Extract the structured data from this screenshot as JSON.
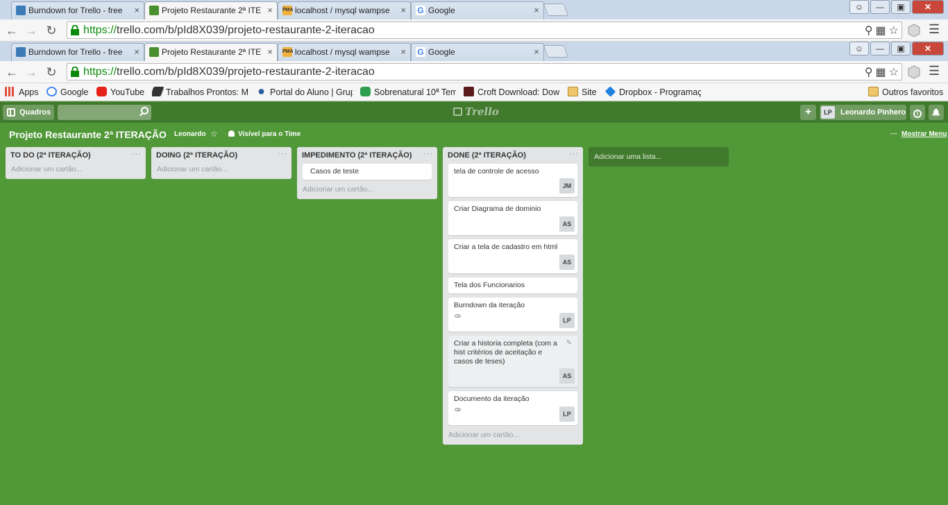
{
  "browser": {
    "tabs": [
      {
        "title": "Burndown for Trello - free",
        "icon": "trello-icon",
        "active": false
      },
      {
        "title": "Projeto Restaurante 2ª ITE",
        "icon": "trello-icon",
        "active": true
      },
      {
        "title": "localhost / mysql wampse",
        "icon": "phpmyadmin-icon",
        "active": false
      },
      {
        "title": "Google",
        "icon": "google-icon",
        "active": false
      }
    ],
    "tab_close": "×",
    "url_scheme": "https://",
    "url_rest": "trello.com/b/pId8X039/projeto-restaurante-2-iteracao",
    "pma_label": "PMA",
    "google_glyph": "G"
  },
  "bookmarks": [
    {
      "label": "Apps",
      "icon": "apps-icon"
    },
    {
      "label": "Google",
      "icon": "google-icon"
    },
    {
      "label": "YouTube",
      "icon": "youtube-icon"
    },
    {
      "label": "Trabalhos Prontos: Mo",
      "icon": "bookmark-icon"
    },
    {
      "label": "Portal do Aluno | Grup",
      "icon": "portal-icon"
    },
    {
      "label": "Sobrenatural 10ª Tem",
      "icon": "tv-icon"
    },
    {
      "label": "Croft Download: Dow",
      "icon": "croft-icon"
    },
    {
      "label": "Site",
      "icon": "folder-icon"
    },
    {
      "label": "Dropbox - Programaç",
      "icon": "dropbox-icon"
    },
    {
      "label": "Outros favoritos",
      "icon": "folder-icon"
    }
  ],
  "trello_header": {
    "boards_button": "Quadros",
    "logo": "Trello",
    "add_symbol": "+",
    "member_initials": "LP",
    "member_name": "Leonardo Pinhero",
    "info_symbol": "i",
    "notif_symbol": "🔔"
  },
  "board": {
    "title": "Projeto Restaurante 2ª ITERAÇÃO",
    "org": "Leonardo",
    "star": "☆",
    "visibility": "Visível para o Time",
    "menu_dots": "···",
    "show_menu": "Mostrar Menu"
  },
  "lists": [
    {
      "title": "TO DO (2ª ITERAÇÃO)",
      "menu": "···",
      "cards": [],
      "add_card": "Adicionar um cartão..."
    },
    {
      "title": "DOING (2ª ITERAÇÃO)",
      "menu": "···",
      "cards": [],
      "add_card": "Adicionar um cartão..."
    },
    {
      "title": "IMPEDIMENTO (2ª ITERAÇÃO)",
      "menu": "···",
      "cards": [
        {
          "title": "Casos de teste",
          "member": "",
          "watched": false
        }
      ],
      "add_card": "Adicionar um cartão..."
    },
    {
      "title": "DONE (2ª ITERAÇÃO)",
      "menu": "···",
      "cards": [
        {
          "title": "tela de controle de acesso",
          "member": "JM",
          "watched": false
        },
        {
          "title": "Criar Diagrama de dominio",
          "member": "AS",
          "watched": false
        },
        {
          "title": "Criar a tela de cadastro em html",
          "member": "AS",
          "watched": false
        },
        {
          "title": "Tela dos Funcionarios",
          "member": "",
          "watched": false
        },
        {
          "title": "Burndown da iteração",
          "member": "LP",
          "watched": true
        },
        {
          "title": "Criar a historia completa (com a hist critérios de aceitação e casos de teses)",
          "member": "AS",
          "watched": false,
          "editing": true
        },
        {
          "title": "Documento da iteração",
          "member": "LP",
          "watched": true
        }
      ],
      "add_card": "Adicionar um cartão..."
    }
  ],
  "add_list": "Adicionar uma lista...",
  "colors": {
    "board_bg": "#519839",
    "header_bg": "#417a2d",
    "list_bg": "#e2e4e6"
  }
}
